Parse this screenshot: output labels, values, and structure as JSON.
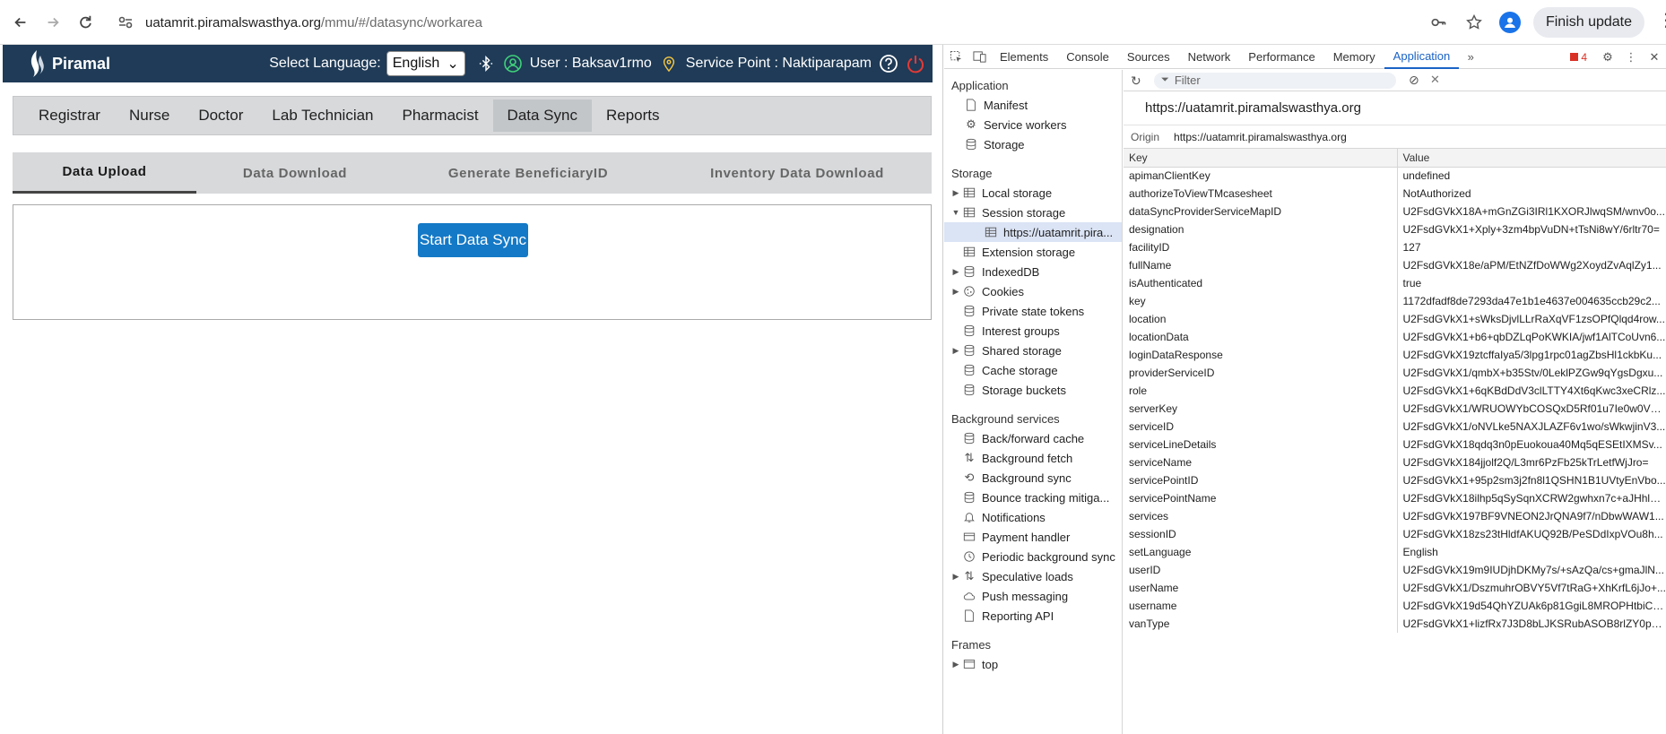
{
  "browser": {
    "url_host": "uatamrit.piramalswasthya.org",
    "url_path": "/mmu/#/datasync/workarea",
    "finish_update_label": "Finish update"
  },
  "app": {
    "logo_text": "Piramal",
    "language_label": "Select Language:",
    "language_value": "English",
    "user_text": "User : Baksav1rmo",
    "service_point_text": "Service Point : Naktiparapam",
    "role_tabs": [
      "Registrar",
      "Nurse",
      "Doctor",
      "Lab Technician",
      "Pharmacist",
      "Data Sync",
      "Reports"
    ],
    "active_role_tab": "Data Sync",
    "sub_tabs": [
      "Data Upload",
      "Data Download",
      "Generate BeneficiaryID",
      "Inventory Data Download"
    ],
    "active_sub_tab": "Data Upload",
    "start_sync_label": "Start Data Sync"
  },
  "devtools": {
    "tabs": [
      "Elements",
      "Console",
      "Sources",
      "Network",
      "Performance",
      "Memory",
      "Application"
    ],
    "active_tab": "Application",
    "error_count": "4",
    "sidebar": {
      "application_heading": "Application",
      "application_items": [
        "Manifest",
        "Service workers",
        "Storage"
      ],
      "storage_heading": "Storage",
      "storage_items": [
        {
          "label": "Local storage",
          "arrow": "▶"
        },
        {
          "label": "Session storage",
          "arrow": "▼"
        },
        {
          "label": "https://uatamrit.pira...",
          "arrow": "",
          "child": true
        },
        {
          "label": "Extension storage",
          "arrow": ""
        },
        {
          "label": "IndexedDB",
          "arrow": "▶"
        },
        {
          "label": "Cookies",
          "arrow": "▶"
        },
        {
          "label": "Private state tokens",
          "arrow": ""
        },
        {
          "label": "Interest groups",
          "arrow": ""
        },
        {
          "label": "Shared storage",
          "arrow": "▶"
        },
        {
          "label": "Cache storage",
          "arrow": ""
        },
        {
          "label": "Storage buckets",
          "arrow": ""
        }
      ],
      "background_heading": "Background services",
      "background_items": [
        {
          "label": "Back/forward cache",
          "arrow": ""
        },
        {
          "label": "Background fetch",
          "arrow": ""
        },
        {
          "label": "Background sync",
          "arrow": ""
        },
        {
          "label": "Bounce tracking mitiga...",
          "arrow": ""
        },
        {
          "label": "Notifications",
          "arrow": ""
        },
        {
          "label": "Payment handler",
          "arrow": ""
        },
        {
          "label": "Periodic background sync",
          "arrow": ""
        },
        {
          "label": "Speculative loads",
          "arrow": "▶"
        },
        {
          "label": "Push messaging",
          "arrow": ""
        },
        {
          "label": "Reporting API",
          "arrow": ""
        }
      ],
      "frames_heading": "Frames",
      "frames_items": [
        {
          "label": "top",
          "arrow": "▶"
        }
      ]
    },
    "filter_placeholder": "Filter",
    "origin_title": "https://uatamrit.piramalswasthya.org",
    "origin_label": "Origin",
    "origin_value": "https://uatamrit.piramalswasthya.org",
    "table_headers": {
      "key": "Key",
      "value": "Value"
    },
    "rows": [
      {
        "key": "apimanClientKey",
        "value": "undefined"
      },
      {
        "key": "authorizeToViewTMcasesheet",
        "value": "NotAuthorized"
      },
      {
        "key": "dataSyncProviderServiceMapID",
        "value": "U2FsdGVkX18A+mGnZGi3IRl1KXORJlwqSM/wnv0o..."
      },
      {
        "key": "designation",
        "value": "U2FsdGVkX1+Xply+3zm4bpVuDN+tTsNi8wY/6rltr70="
      },
      {
        "key": "facilityID",
        "value": "127"
      },
      {
        "key": "fullName",
        "value": "U2FsdGVkX18e/aPM/EtNZfDoWWg2XoydZvAqlZy1..."
      },
      {
        "key": "isAuthenticated",
        "value": "true"
      },
      {
        "key": "key",
        "value": "1172dfadf8de7293da47e1b1e4637e004635ccb29c2..."
      },
      {
        "key": "location",
        "value": "U2FsdGVkX1+sWksDjvlLLrRaXqVF1zsOPfQlqd4row..."
      },
      {
        "key": "locationData",
        "value": "U2FsdGVkX1+b6+qbDZLqPoKWKIA/jwf1AlTCoUvn6..."
      },
      {
        "key": "loginDataResponse",
        "value": "U2FsdGVkX19ztcffaIya5/3lpg1rpc01agZbsHl1ckbKu..."
      },
      {
        "key": "providerServiceID",
        "value": "U2FsdGVkX1/qmbX+b35Stv/0LeklPZGw9qYgsDgxu..."
      },
      {
        "key": "role",
        "value": "U2FsdGVkX1+6qKBdDdV3clLTTY4Xt6qKwc3xeCRlz..."
      },
      {
        "key": "serverKey",
        "value": "U2FsdGVkX1/WRUOWYbCOSQxD5Rf01u7Ie0w0Vqt..."
      },
      {
        "key": "serviceID",
        "value": "U2FsdGVkX1/oNVLke5NAXJLAZF6v1wo/sWkwjinV3..."
      },
      {
        "key": "serviceLineDetails",
        "value": "U2FsdGVkX18qdq3n0pEuokoua40Mq5qESEtIXMSv..."
      },
      {
        "key": "serviceName",
        "value": "U2FsdGVkX184jjolf2Q/L3mr6PzFb25kTrLetfWjJro="
      },
      {
        "key": "servicePointID",
        "value": "U2FsdGVkX1+95p2sm3j2fn8l1QSHN1B1UVtyEnVbo..."
      },
      {
        "key": "servicePointName",
        "value": "U2FsdGVkX18ilhp5qSySqnXCRW2gwhxn7c+aJHhlbI0="
      },
      {
        "key": "services",
        "value": "U2FsdGVkX197BF9VNEON2JrQNA9f7/nDbwWAW1..."
      },
      {
        "key": "sessionID",
        "value": "U2FsdGVkX18zs23tHldfAKUQ92B/PeSDdIxpVOu8h..."
      },
      {
        "key": "setLanguage",
        "value": "English"
      },
      {
        "key": "userID",
        "value": "U2FsdGVkX19m9IUDjhDKMy7s/+sAzQa/cs+gmaJlN..."
      },
      {
        "key": "userName",
        "value": "U2FsdGVkX1/DszmuhrOBVY5Vf7tRaG+XhKrfL6jJo+..."
      },
      {
        "key": "username",
        "value": "U2FsdGVkX19d54QhYZUAk6p81GgiL8MROPHtbiC0..."
      },
      {
        "key": "vanType",
        "value": "U2FsdGVkX1+lizfRx7J3D8bLJKSRubASOB8rlZY0pgI="
      }
    ]
  },
  "colors": {
    "app_header_bg": "#1f3b57",
    "sync_button_bg": "#1479c6",
    "devtools_accent": "#1a62c6"
  }
}
